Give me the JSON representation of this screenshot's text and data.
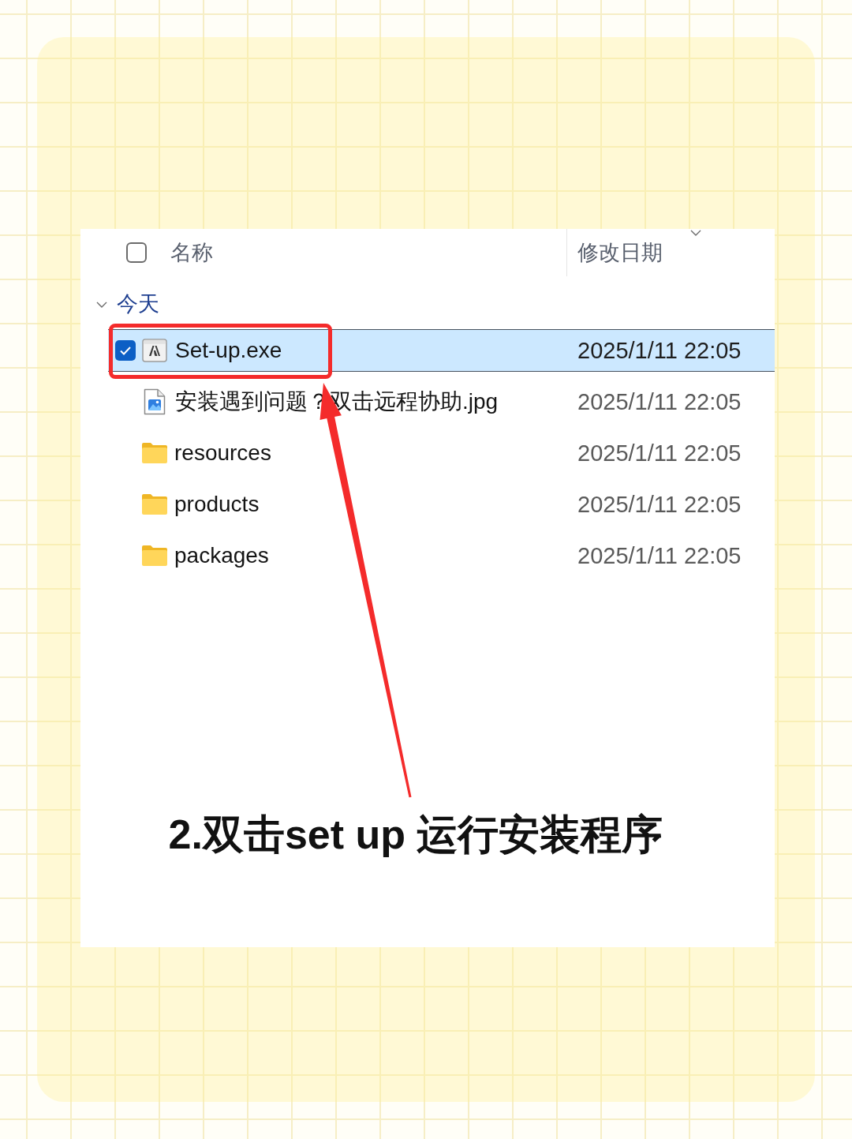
{
  "header": {
    "checked": false,
    "columns": [
      {
        "label": "名称",
        "sorted": false
      },
      {
        "label": "修改日期",
        "sorted": true
      }
    ]
  },
  "group": {
    "label": "今天",
    "expanded": true
  },
  "files": [
    {
      "kind": "app",
      "name": "Set-up.exe",
      "date": "2025/1/11 22:05",
      "selected": true,
      "checked": true,
      "highlighted": true
    },
    {
      "kind": "image",
      "name": "安装遇到问题？双击远程协助.jpg",
      "date": "2025/1/11 22:05",
      "selected": false,
      "checked": false,
      "highlighted": false
    },
    {
      "kind": "folder",
      "name": "resources",
      "date": "2025/1/11 22:05",
      "selected": false,
      "checked": false,
      "highlighted": false
    },
    {
      "kind": "folder",
      "name": "products",
      "date": "2025/1/11 22:05",
      "selected": false,
      "checked": false,
      "highlighted": false
    },
    {
      "kind": "folder",
      "name": "packages",
      "date": "2025/1/11 22:05",
      "selected": false,
      "checked": false,
      "highlighted": false
    }
  ],
  "caption": "2.双击set up 运行安装程序"
}
